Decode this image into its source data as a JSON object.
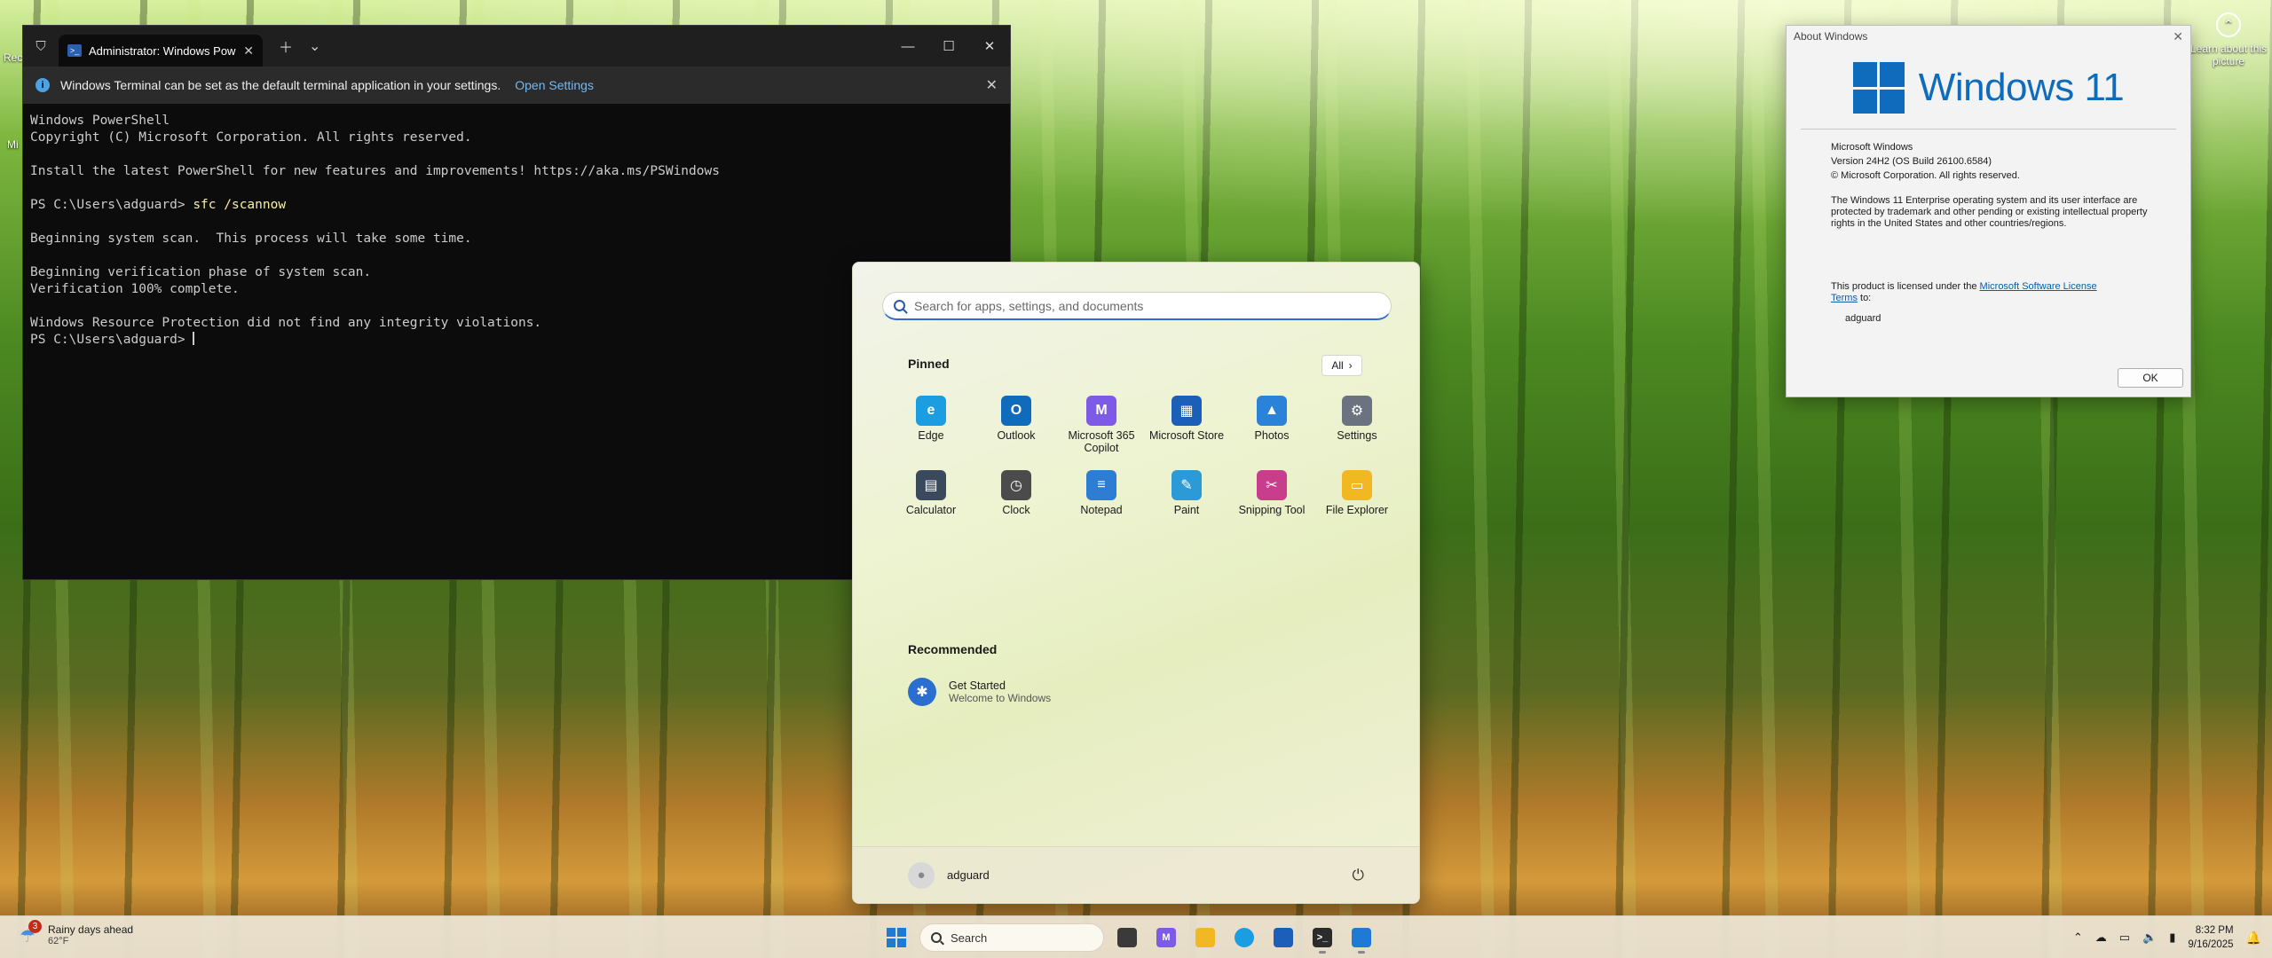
{
  "desktop": {
    "icon_partial_1": "Rec",
    "icon_partial_2": "Mi",
    "learn_about": "Learn about this picture"
  },
  "terminal": {
    "tab_title": "Administrator: Windows PowerShell",
    "banner_text": "Windows Terminal can be set as the default terminal application in your settings.",
    "banner_link": "Open Settings",
    "lines": [
      "Windows PowerShell",
      "Copyright (C) Microsoft Corporation. All rights reserved.",
      "",
      "Install the latest PowerShell for new features and improvements! https://aka.ms/PSWindows",
      ""
    ],
    "prompt": "PS C:\\Users\\adguard> ",
    "command": "sfc /scannow",
    "output": [
      "",
      "Beginning system scan.  This process will take some time.",
      "",
      "Beginning verification phase of system scan.",
      "Verification 100% complete.",
      "",
      "Windows Resource Protection did not find any integrity violations."
    ],
    "final_prompt": "PS C:\\Users\\adguard> "
  },
  "start": {
    "search_placeholder": "Search for apps, settings, and documents",
    "pinned_title": "Pinned",
    "all_label": "All",
    "apps": [
      {
        "label": "Edge",
        "icon": "edge-icon",
        "color": "#1b9de2",
        "glyph": "e"
      },
      {
        "label": "Outlook",
        "icon": "outlook-icon",
        "color": "#0f6cbd",
        "glyph": "O"
      },
      {
        "label": "Microsoft 365 Copilot",
        "icon": "m365-copilot-icon",
        "color": "#7d5be6",
        "glyph": "M"
      },
      {
        "label": "Microsoft Store",
        "icon": "store-icon",
        "color": "#1b5fb8",
        "glyph": "▦"
      },
      {
        "label": "Photos",
        "icon": "photos-icon",
        "color": "#2a83d8",
        "glyph": "▲"
      },
      {
        "label": "Settings",
        "icon": "settings-icon",
        "color": "#6b7280",
        "glyph": "⚙"
      },
      {
        "label": "Calculator",
        "icon": "calculator-icon",
        "color": "#3a4a5c",
        "glyph": "▤"
      },
      {
        "label": "Clock",
        "icon": "clock-icon",
        "color": "#4b4b4b",
        "glyph": "◷"
      },
      {
        "label": "Notepad",
        "icon": "notepad-icon",
        "color": "#2d7dd2",
        "glyph": "≡"
      },
      {
        "label": "Paint",
        "icon": "paint-icon",
        "color": "#2c9ad6",
        "glyph": "✎"
      },
      {
        "label": "Snipping Tool",
        "icon": "snipping-tool-icon",
        "color": "#c83d8c",
        "glyph": "✂"
      },
      {
        "label": "File Explorer",
        "icon": "file-explorer-icon",
        "color": "#f2b824",
        "glyph": "▭"
      }
    ],
    "recommended_title": "Recommended",
    "recommended": {
      "title": "Get Started",
      "subtitle": "Welcome to Windows"
    },
    "user_name": "adguard"
  },
  "about": {
    "title": "About Windows",
    "logo_text": "Windows 11",
    "product": "Microsoft Windows",
    "version": "Version 24H2 (OS Build 26100.6584)",
    "copyright": "© Microsoft Corporation. All rights reserved.",
    "description": "The Windows 11 Enterprise operating system and its user interface are protected by trademark and other pending or existing intellectual property rights in the United States and other countries/regions.",
    "license_prefix": "This product is licensed under the ",
    "license_link": "Microsoft Software License Terms",
    "license_suffix": " to:",
    "licensee": "adguard",
    "ok_label": "OK"
  },
  "taskbar": {
    "weather_badge": "3",
    "weather_title": "Rainy days ahead",
    "weather_temp": "62°F",
    "search_label": "Search",
    "m365_glyph": "M",
    "time": "8:32 PM",
    "date": "9/16/2025"
  }
}
